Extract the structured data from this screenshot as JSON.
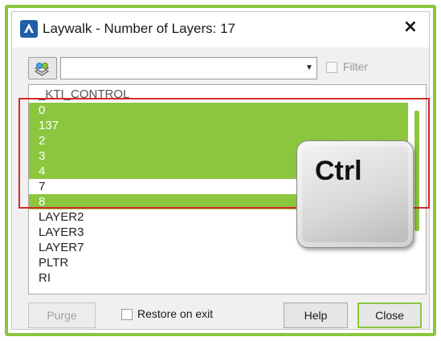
{
  "window": {
    "title": "Laywalk - Number of Layers: 17",
    "close_symbol": "×"
  },
  "toolbar": {
    "select_objects_icon": "layer-select-icon",
    "combo_value": "",
    "combo_arrow": "▼",
    "filter_label": "Filter",
    "filter_checked": false
  },
  "layers": [
    {
      "name": "_KTI_CONTROL",
      "selected": false
    },
    {
      "name": "0",
      "selected": true
    },
    {
      "name": "137",
      "selected": true
    },
    {
      "name": "2",
      "selected": true
    },
    {
      "name": "3",
      "selected": true
    },
    {
      "name": "4",
      "selected": true
    },
    {
      "name": "7",
      "selected": false
    },
    {
      "name": "8",
      "selected": true
    },
    {
      "name": "LAYER2",
      "selected": false
    },
    {
      "name": "LAYER3",
      "selected": false
    },
    {
      "name": "LAYER7",
      "selected": false
    },
    {
      "name": "PLTR",
      "selected": false
    },
    {
      "name": "RI",
      "selected": false
    }
  ],
  "overlay": {
    "key_label": "Ctrl"
  },
  "footer": {
    "purge_label": "Purge",
    "restore_label": "Restore on exit",
    "restore_checked": false,
    "help_label": "Help",
    "close_label": "Close"
  },
  "colors": {
    "accent": "#8cc63f",
    "highlight_box": "#d42a2a"
  }
}
